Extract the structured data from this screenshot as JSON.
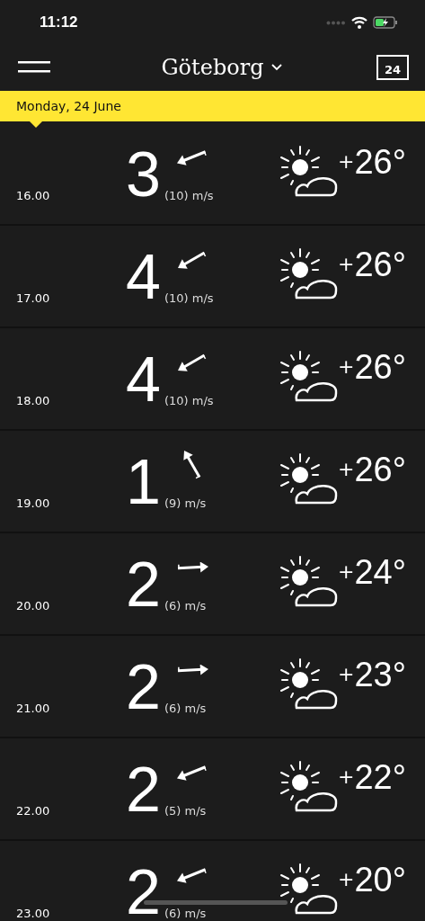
{
  "status_bar": {
    "time": "11:12"
  },
  "header": {
    "city": "Göteborg",
    "calendar_day": "24"
  },
  "date_bar": {
    "label": "Monday, 24 June"
  },
  "hours": [
    {
      "time": "16.00",
      "wind": "3",
      "gust": "(10) m/s",
      "wind_arrow": {
        "kind": "wsw"
      },
      "sign": "+",
      "temperature": "26°"
    },
    {
      "time": "17.00",
      "wind": "4",
      "gust": "(10) m/s",
      "wind_arrow": {
        "kind": "sw"
      },
      "sign": "+",
      "temperature": "26°"
    },
    {
      "time": "18.00",
      "wind": "4",
      "gust": "(10) m/s",
      "wind_arrow": {
        "kind": "sw"
      },
      "sign": "+",
      "temperature": "26°"
    },
    {
      "time": "19.00",
      "wind": "1",
      "gust": "(9) m/s",
      "wind_arrow": {
        "kind": "nnw"
      },
      "sign": "+",
      "temperature": "26°"
    },
    {
      "time": "20.00",
      "wind": "2",
      "gust": "(6) m/s",
      "wind_arrow": {
        "kind": "e"
      },
      "sign": "+",
      "temperature": "24°"
    },
    {
      "time": "21.00",
      "wind": "2",
      "gust": "(6) m/s",
      "wind_arrow": {
        "kind": "e"
      },
      "sign": "+",
      "temperature": "23°"
    },
    {
      "time": "22.00",
      "wind": "2",
      "gust": "(5) m/s",
      "wind_arrow": {
        "kind": "wsw"
      },
      "sign": "+",
      "temperature": "22°"
    },
    {
      "time": "23.00",
      "wind": "2",
      "gust": "(6) m/s",
      "wind_arrow": {
        "kind": "wsw"
      },
      "sign": "+",
      "temperature": "20°"
    }
  ]
}
